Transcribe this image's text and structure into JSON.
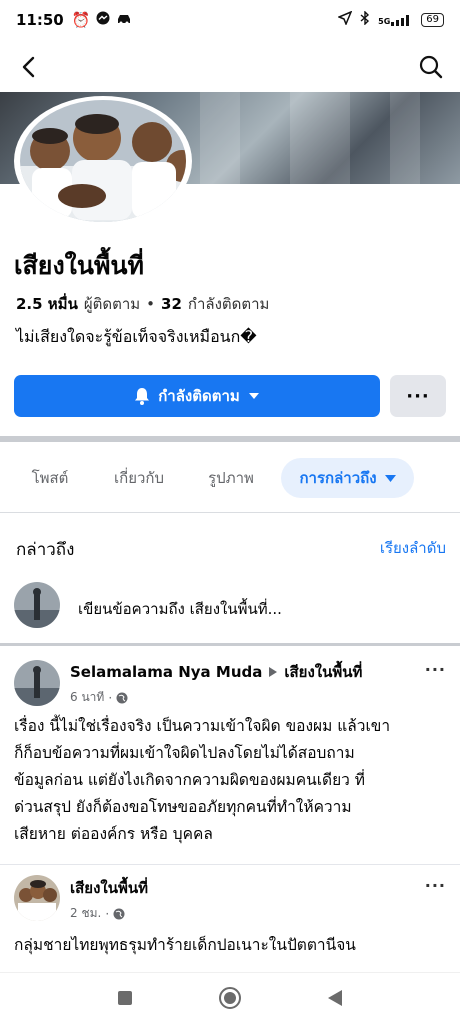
{
  "status_bar": {
    "time": "11:50",
    "battery": "69",
    "network": "5G"
  },
  "page": {
    "name": "เสียงในพื้นที่",
    "followers_count": "2.5 หมื่น",
    "followers_label": "ผู้ติดตาม",
    "following_count": "32",
    "following_label": "กำลังติดตาม",
    "bio": "ไม่เสียงใดจะรู้ข้อเท็จจริงเหมือนก�"
  },
  "actions": {
    "follow_label": "กำลังติดตาม",
    "more_label": "···"
  },
  "tabs": [
    {
      "label": "โพสต์",
      "active": false
    },
    {
      "label": "เกี่ยวกับ",
      "active": false
    },
    {
      "label": "รูปภาพ",
      "active": false
    },
    {
      "label": "การกล่าวถึง",
      "active": true
    }
  ],
  "mentions": {
    "title": "กล่าวถึง",
    "sort_label": "เรียงลำดับ",
    "composer_placeholder": "เขียนข้อความถึง เสียงในพื้นที่..."
  },
  "posts": [
    {
      "author": "Selamalama Nya Muda",
      "target": "เสียงในพื้นที่",
      "time": "6 นาที",
      "lines": [
        "เรื่อง นี้ไม่ใช่เรื่องจริง เป็นความเข้าใจผิด ของผม แล้วเขา",
        "ก็ก็อบข้อความที่ผมเข้าใจผิดไปลงโดยไม่ได้สอบถาม",
        "ข้อมูลก่อน แต่ยังไงเกิดจากความผิดของผมคนเดียว ที่",
        "ด่วนสรุป ยังก็ต้องขอโทษขออภัยทุกคนที่ทำให้ความ",
        "เสียหาย ต่อองค์กร หรือ บุคคล"
      ]
    },
    {
      "author": "เสียงในพื้นที่",
      "time": "2 ชม.",
      "lines": [
        "กลุ่มชายไทยพุทธรุมทำร้ายเด็กปอเนาะในปัตตานีจน"
      ]
    }
  ],
  "colors": {
    "accent": "#1877f2",
    "tab_active_bg": "#e7f0fd",
    "secondary_btn": "#e4e6eb"
  }
}
